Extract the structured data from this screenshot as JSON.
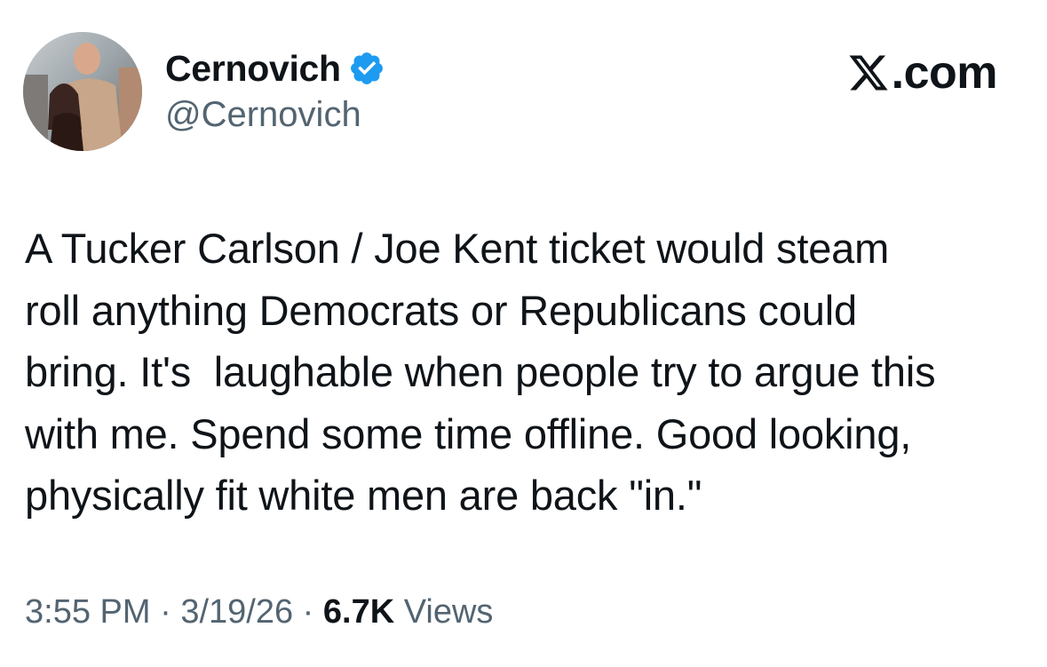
{
  "author": {
    "display_name": "Cernovich",
    "handle": "@Cernovich",
    "verified": true,
    "avatar": "profile-photo"
  },
  "brand": {
    "logo_text": ".com",
    "logo_icon": "x-logo-icon"
  },
  "tweet": {
    "text": "A Tucker Carlson / Joe Kent ticket would steam\nroll anything Democrats or Republicans could\nbring. It's  laughable when people try to argue this\nwith me. Spend some time offline. Good looking,\nphysically fit white men are back \"in.\""
  },
  "meta": {
    "time": "3:55 PM",
    "separator": " · ",
    "date": "3/19/26",
    "views_count": "6.7K",
    "views_label": " Views"
  },
  "colors": {
    "text": "#0f1419",
    "secondary": "#536471",
    "verified": "#1d9bf0"
  }
}
